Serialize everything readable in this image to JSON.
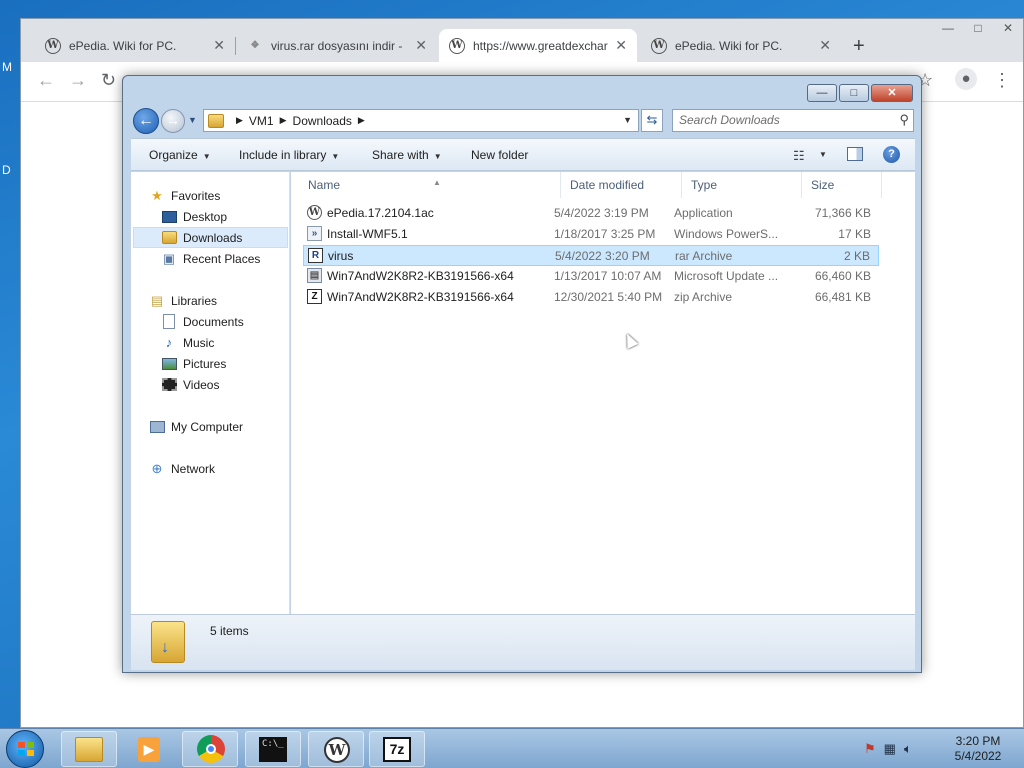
{
  "desktop": {
    "edge_letters": [
      "M",
      "D"
    ]
  },
  "browser": {
    "tabs": [
      {
        "title": "ePedia. Wiki for PC."
      },
      {
        "title": "virus.rar dosyasını indir - "
      },
      {
        "title": "https://www.greatdexchar"
      },
      {
        "title": "ePedia. Wiki for PC."
      }
    ],
    "new_tab": "+",
    "favicon_letter": "W"
  },
  "explorer": {
    "caption": {
      "minimize": "—",
      "maximize": "□",
      "close": "✕"
    },
    "address": {
      "crumbs": [
        "VM1",
        "Downloads"
      ]
    },
    "search": {
      "placeholder": "Search Downloads"
    },
    "commands": {
      "organize": "Organize",
      "include": "Include in library",
      "share": "Share with",
      "new_folder": "New folder"
    },
    "nav": {
      "favorites": "Favorites",
      "desktop": "Desktop",
      "downloads": "Downloads",
      "recent": "Recent Places",
      "libraries": "Libraries",
      "documents": "Documents",
      "music": "Music",
      "pictures": "Pictures",
      "videos": "Videos",
      "computer": "My Computer",
      "network": "Network"
    },
    "columns": {
      "name": "Name",
      "date": "Date modified",
      "type": "Type",
      "size": "Size"
    },
    "files": [
      {
        "icon": "W",
        "name": "ePedia.17.2104.1ac",
        "date": "5/4/2022 3:19 PM",
        "type": "Application",
        "size": "71,366 KB"
      },
      {
        "icon": "»",
        "name": "Install-WMF5.1",
        "date": "1/18/2017 3:25 PM",
        "type": "Windows PowerS...",
        "size": "17 KB"
      },
      {
        "icon": "R",
        "name": "virus",
        "date": "5/4/2022 3:20 PM",
        "type": "rar Archive",
        "size": "2 KB"
      },
      {
        "icon": "▤",
        "name": "Win7AndW2K8R2-KB3191566-x64",
        "date": "1/13/2017 10:07 AM",
        "type": "Microsoft Update ...",
        "size": "66,460 KB"
      },
      {
        "icon": "Z",
        "name": "Win7AndW2K8R2-KB3191566-x64",
        "date": "12/30/2021 5:40 PM",
        "type": "zip Archive",
        "size": "66,481 KB"
      }
    ],
    "status": {
      "item_count": "5 items"
    }
  },
  "taskbar": {
    "clock_time": "3:20 PM",
    "clock_date": "5/4/2022",
    "terminal_glyph": "C:\\_",
    "sevenzip_glyph": "7z"
  },
  "colors": {
    "selection": "#cce8ff",
    "window_frame": "#c1d5ea",
    "desktop": "#1a76c7"
  }
}
